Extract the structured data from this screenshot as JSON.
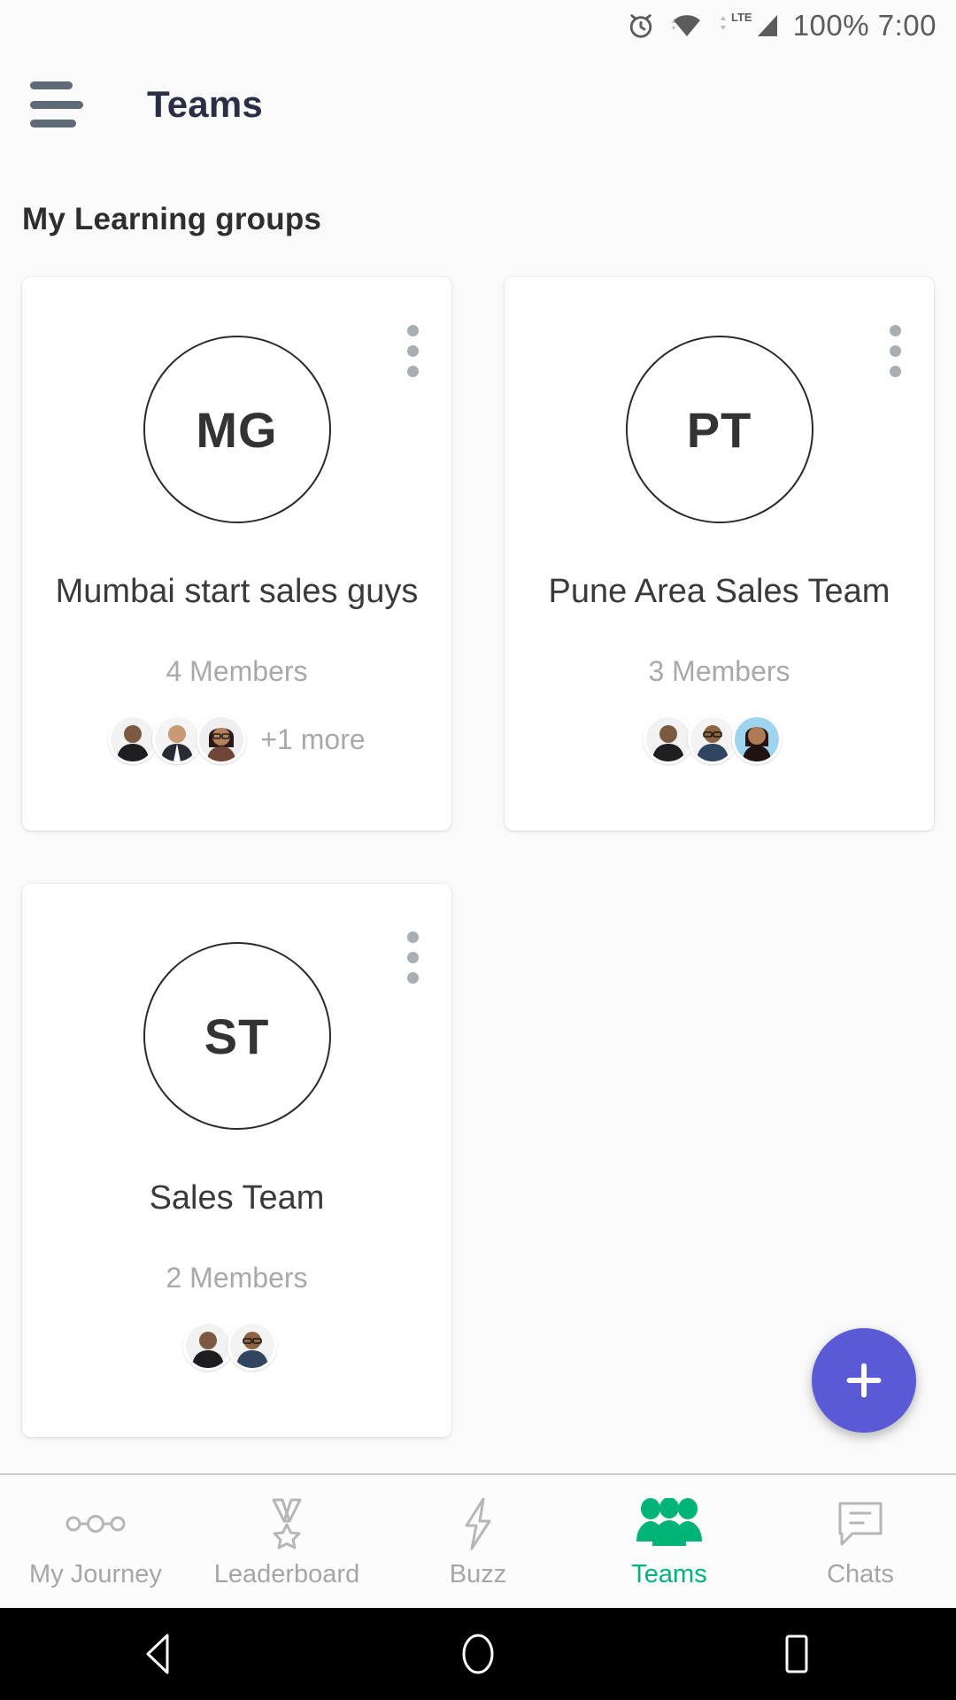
{
  "status_bar": {
    "battery_percent": "100%",
    "time": "7:00",
    "combined_text": "100% 7:00",
    "icons": [
      "alarm-clock-icon",
      "wifi-icon",
      "lte-signal-icon"
    ],
    "network_label": "LTE"
  },
  "header": {
    "menu_icon": "hamburger-menu-icon",
    "title": "Teams"
  },
  "section": {
    "heading": "My Learning groups"
  },
  "colors": {
    "accent_green": "#00B377",
    "fab_purple": "#5A5AD6",
    "page_background": "#FAFAFA",
    "card_background": "#FFFFFF",
    "muted_text": "#A9A9A9"
  },
  "teams": [
    {
      "initials": "MG",
      "name": "Mumbai start sales guys",
      "members_label": "4 Members",
      "member_count": 4,
      "avatars_shown": 3,
      "more_label": "+1 more",
      "menu_icon": "more-vertical-icon"
    },
    {
      "initials": "PT",
      "name": "Pune Area Sales Team",
      "members_label": "3 Members",
      "member_count": 3,
      "avatars_shown": 3,
      "more_label": "",
      "menu_icon": "more-vertical-icon"
    },
    {
      "initials": "ST",
      "name": "Sales Team",
      "members_label": "2 Members",
      "member_count": 2,
      "avatars_shown": 2,
      "more_label": "",
      "menu_icon": "more-vertical-icon"
    }
  ],
  "fab": {
    "icon": "plus-icon",
    "label": "Add"
  },
  "bottom_nav": {
    "items": [
      {
        "label": "My Journey",
        "icon": "journey-path-icon",
        "active": false
      },
      {
        "label": "Leaderboard",
        "icon": "medal-icon",
        "active": false
      },
      {
        "label": "Buzz",
        "icon": "lightning-bolt-icon",
        "active": false
      },
      {
        "label": "Teams",
        "icon": "people-group-icon",
        "active": true
      },
      {
        "label": "Chats",
        "icon": "chat-bubble-icon",
        "active": false
      }
    ]
  },
  "system_nav": {
    "back": "back-triangle-icon",
    "home": "home-circle-icon",
    "recents": "recents-square-icon"
  }
}
